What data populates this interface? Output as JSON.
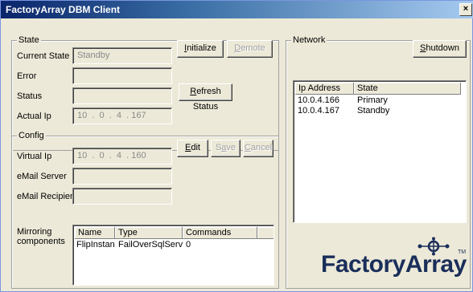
{
  "window": {
    "title": "FactoryArray DBM Client",
    "close_glyph": "×"
  },
  "state": {
    "legend": "State",
    "current_state_label": "Current State",
    "current_state_value": "Standby",
    "error_label": "Error",
    "error_value": "",
    "status_label": "Status",
    "status_value": "",
    "actual_ip_label": "Actual Ip",
    "actual_ip_value": "10  .  0  .  4  . 167",
    "initialize_button": "Initialize",
    "demote_button": "Demote",
    "refresh_status_button": "Refresh Status"
  },
  "config": {
    "legend": "Config",
    "virtual_ip_label": "Virtual Ip",
    "virtual_ip_value": "10  .  0  .  4  . 160",
    "email_server_label": "eMail Server",
    "email_server_value": "",
    "email_recipient_label": "eMail Recipient",
    "email_recipient_value": "",
    "edit_button": "Edit",
    "save_button": "Save",
    "cancel_button": "Cancel",
    "mirroring_label_1": "Mirroring",
    "mirroring_label_2": "components",
    "mirroring_columns": [
      "Name",
      "Type",
      "Commands"
    ],
    "mirroring_rows": [
      {
        "name": "FlipInstan...",
        "type": "FailOverSqlServer",
        "commands": "0"
      }
    ]
  },
  "network": {
    "legend": "Network",
    "shutdown_button": "Shutdown",
    "columns": [
      "Ip Address",
      "State"
    ],
    "rows": [
      {
        "ip": "10.0.4.166",
        "state": "Primary"
      },
      {
        "ip": "10.0.4.167",
        "state": "Standby"
      }
    ]
  },
  "logo": {
    "text": "FactoryArray",
    "tm": "TM",
    "icon": "network-nodes-icon",
    "color": "#1a2e5a"
  }
}
